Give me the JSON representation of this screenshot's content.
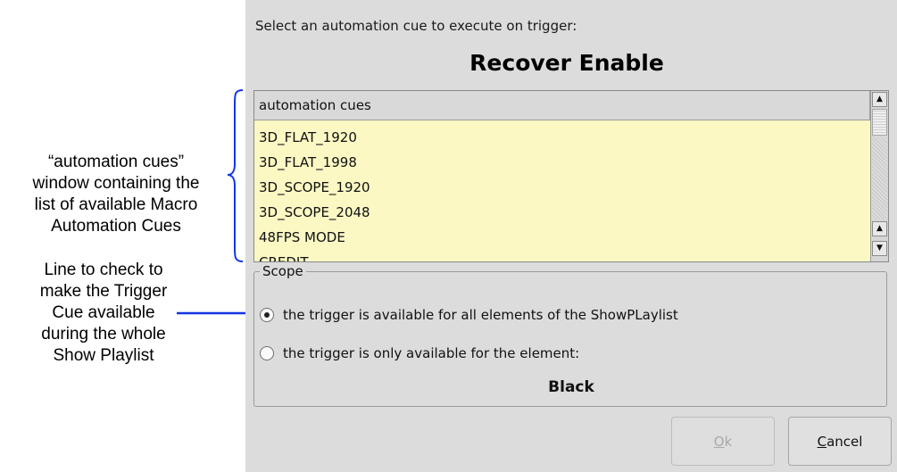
{
  "annotations": {
    "list_note": [
      "“automation cues”",
      "window containing the",
      "list of available Macro",
      "Automation Cues"
    ],
    "scope_note": [
      "Line to check to",
      "make the Trigger",
      "Cue available",
      "during the whole",
      "Show Playlist"
    ],
    "arrow_color": "#1434e6"
  },
  "dialog": {
    "prompt": "Select an automation cue to execute on trigger:",
    "cue_name": "Recover Enable",
    "list": {
      "header": "automation cues",
      "items": [
        "3D_FLAT_1920",
        "3D_FLAT_1998",
        "3D_SCOPE_1920",
        "3D_SCOPE_2048",
        "48FPS MODE",
        "CREDIT"
      ],
      "background_color": "#fbf8c4"
    },
    "scope": {
      "legend": "Scope",
      "options": [
        {
          "label": "the trigger is available for all elements of the ShowPLaylist",
          "selected": true
        },
        {
          "label": "the trigger is only available for the element:",
          "selected": false
        }
      ],
      "element_name": "Black"
    },
    "buttons": {
      "ok": "Ok",
      "cancel": "Cancel",
      "ok_enabled": false
    }
  }
}
